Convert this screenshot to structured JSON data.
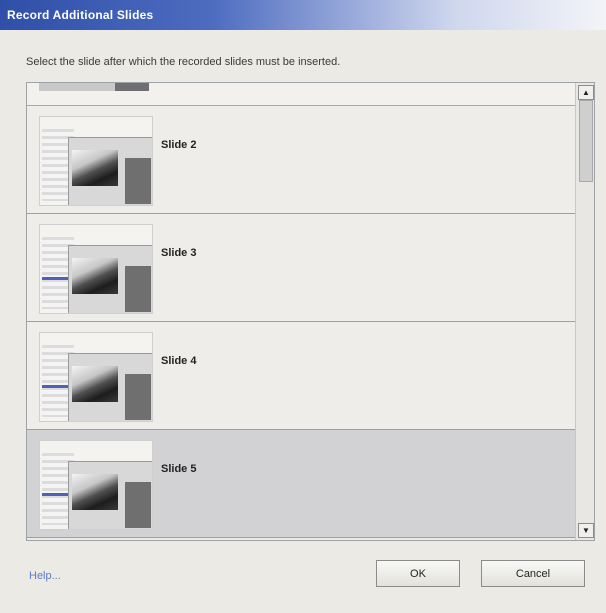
{
  "window": {
    "title": "Record Additional Slides"
  },
  "instruction": "Select the slide after which the recorded slides must be inserted.",
  "slides": [
    {
      "label": "Slide 2",
      "selected": false
    },
    {
      "label": "Slide 3",
      "selected": false
    },
    {
      "label": "Slide 4",
      "selected": false
    },
    {
      "label": "Slide 5",
      "selected": true
    }
  ],
  "footer": {
    "help_label": "Help...",
    "ok_label": "OK",
    "cancel_label": "Cancel"
  },
  "colors": {
    "titlebar": "#2f4fa8",
    "selected_row": "#d2d2d4",
    "help_link": "#5a7bc4"
  }
}
